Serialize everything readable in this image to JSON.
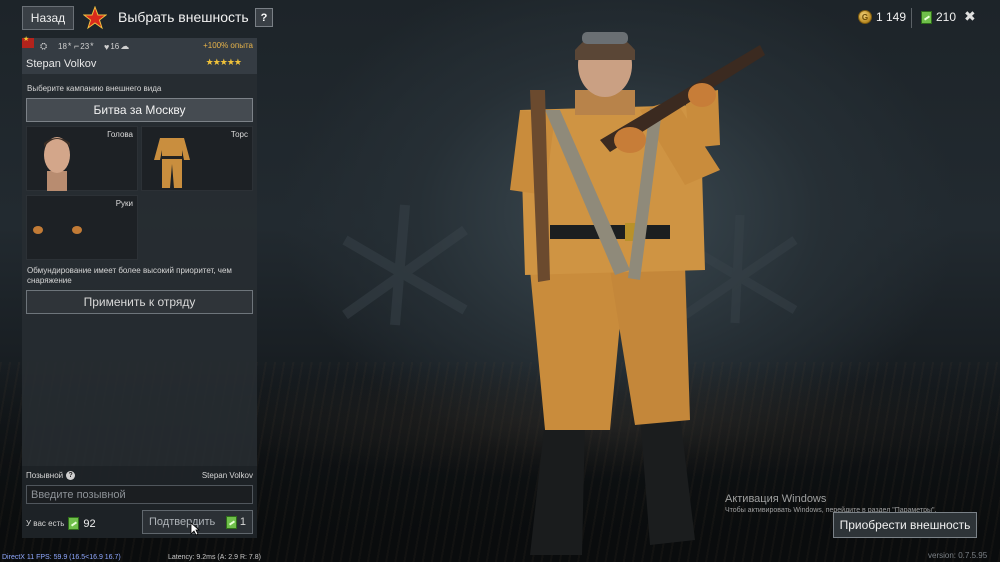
{
  "header": {
    "back_label": "Назад",
    "title": "Выбрать внешность",
    "help_label": "?",
    "gold_amount": "1 149",
    "tickets_amount": "210",
    "close_label": "✖"
  },
  "soldier": {
    "exp_bonus": "+100% опыта",
    "name": "Stepan Volkov",
    "rating": "★★★★★",
    "stats": [
      "18",
      "23",
      "16"
    ]
  },
  "campaign": {
    "label": "Выберите кампанию внешнего вида",
    "selected": "Битва за Москву"
  },
  "slots": {
    "head": "Голова",
    "torso": "Торс",
    "hands": "Руки"
  },
  "note": "Обмундирование имеет более высокий приоритет, чем снаряжение",
  "apply_label": "Применить к отряду",
  "callsign": {
    "label": "Позывной",
    "current": "Stepan Volkov",
    "placeholder": "Введите позывной",
    "have_label": "У вас есть",
    "have_count": "92",
    "confirm_label": "Подтвердить",
    "cost": "1"
  },
  "buy_label": "Приобрести внешность",
  "windows": {
    "title": "Активация Windows",
    "subtitle": "Чтобы активировать Windows, перейдите в раздел \"Параметры\"."
  },
  "footer": {
    "fps": "DirectX 11 FPS: 59.9 (16.5<16.9 16.7)",
    "latency": "Latency: 9.2ms (A: 2.9 R: 7.8)",
    "version": "version: 0.7.5.95"
  }
}
